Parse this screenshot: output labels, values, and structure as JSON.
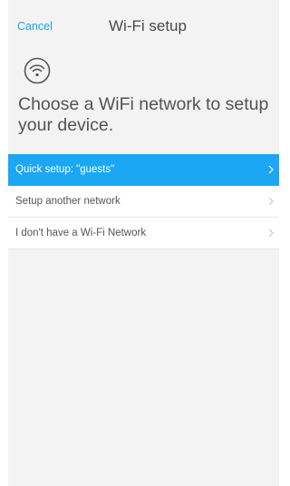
{
  "header": {
    "cancel_label": "Cancel",
    "title": "Wi-Fi setup"
  },
  "intro": {
    "icon": "wifi-icon",
    "heading": "Choose a WiFi network to setup your device."
  },
  "menu": {
    "items": [
      {
        "label": "Quick setup: \"guests\"",
        "active": true,
        "icon": "chevron-right-icon"
      },
      {
        "label": "Setup another network",
        "active": false,
        "icon": "chevron-right-icon"
      },
      {
        "label": "I don't have a Wi-Fi Network",
        "active": false,
        "icon": "chevron-right-icon"
      }
    ]
  },
  "colors": {
    "accent": "#1ba7f3",
    "link": "#21a0e8",
    "panel_background": "#f3f3f3",
    "text": "#545454"
  }
}
